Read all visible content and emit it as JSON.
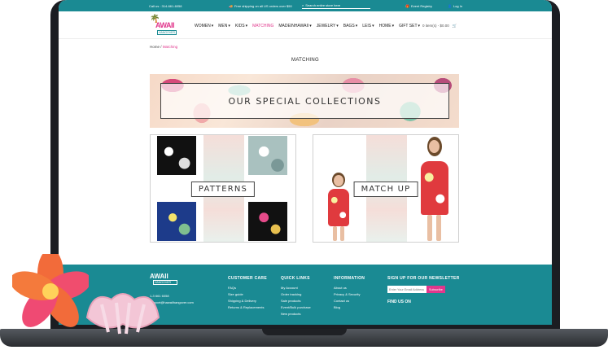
{
  "topbar": {
    "call": "Call us : 314-661-6058",
    "shipping": "Free shipping on all US orders over $50",
    "search_placeholder": "Search entire store here",
    "registry": "Event Registry",
    "login": "Log In"
  },
  "logo": {
    "word": "AWAII",
    "sub": "HANGOVER"
  },
  "nav": [
    {
      "label": "WOMEN",
      "dropdown": true,
      "active": false
    },
    {
      "label": "MEN",
      "dropdown": true,
      "active": false
    },
    {
      "label": "KIDS",
      "dropdown": true,
      "active": false
    },
    {
      "label": "MATCHING",
      "dropdown": false,
      "active": true
    },
    {
      "label": "MADEINHAWAII",
      "dropdown": true,
      "active": false
    },
    {
      "label": "JEWELRY",
      "dropdown": true,
      "active": false
    },
    {
      "label": "BAGS",
      "dropdown": true,
      "active": false
    },
    {
      "label": "LEIS",
      "dropdown": true,
      "active": false
    },
    {
      "label": "HOME",
      "dropdown": true,
      "active": false
    },
    {
      "label": "GIFT SET",
      "dropdown": true,
      "active": false
    }
  ],
  "cart": {
    "summary": "0 item(s) - $0.00"
  },
  "breadcrumb": {
    "home": "Home",
    "sep": "/",
    "current": "Matching"
  },
  "page_title": "MATCHING",
  "banner": {
    "label": "OUR SPECIAL COLLECTIONS"
  },
  "tiles": {
    "patterns": "PATTERNS",
    "matchup": "MATCH UP"
  },
  "footer": {
    "logo_word": "AWAII",
    "logo_sub": "HANGOVER",
    "phone": "1-3 661 6058",
    "email": "support@hawaiihangover.com",
    "customer_care": {
      "title": "CUSTOMER CARE",
      "items": [
        "FAQs",
        "Size guide",
        "Shipping & Delivery",
        "Returns & Replacements"
      ]
    },
    "quick_links": {
      "title": "QUICK LINKS",
      "items": [
        "My Account",
        "Order tracking",
        "Sale products",
        "Event/Bulk purchase",
        "New products"
      ]
    },
    "information": {
      "title": "INFORMATION",
      "items": [
        "About us",
        "Privacy & Security",
        "Contact us",
        "Blog"
      ]
    },
    "newsletter": {
      "title": "SIGN UP FOR OUR NEWSLETTER",
      "placeholder": "Enter Your Email Address",
      "button": "Subscribe",
      "find_us": "FIND US ON"
    }
  },
  "colors": {
    "teal": "#1a8a93",
    "pink": "#e1368c"
  },
  "icons": [
    "phone-icon",
    "truck-icon",
    "search-icon",
    "gift-icon",
    "user-icon",
    "cart-icon",
    "chevron-down-icon"
  ]
}
